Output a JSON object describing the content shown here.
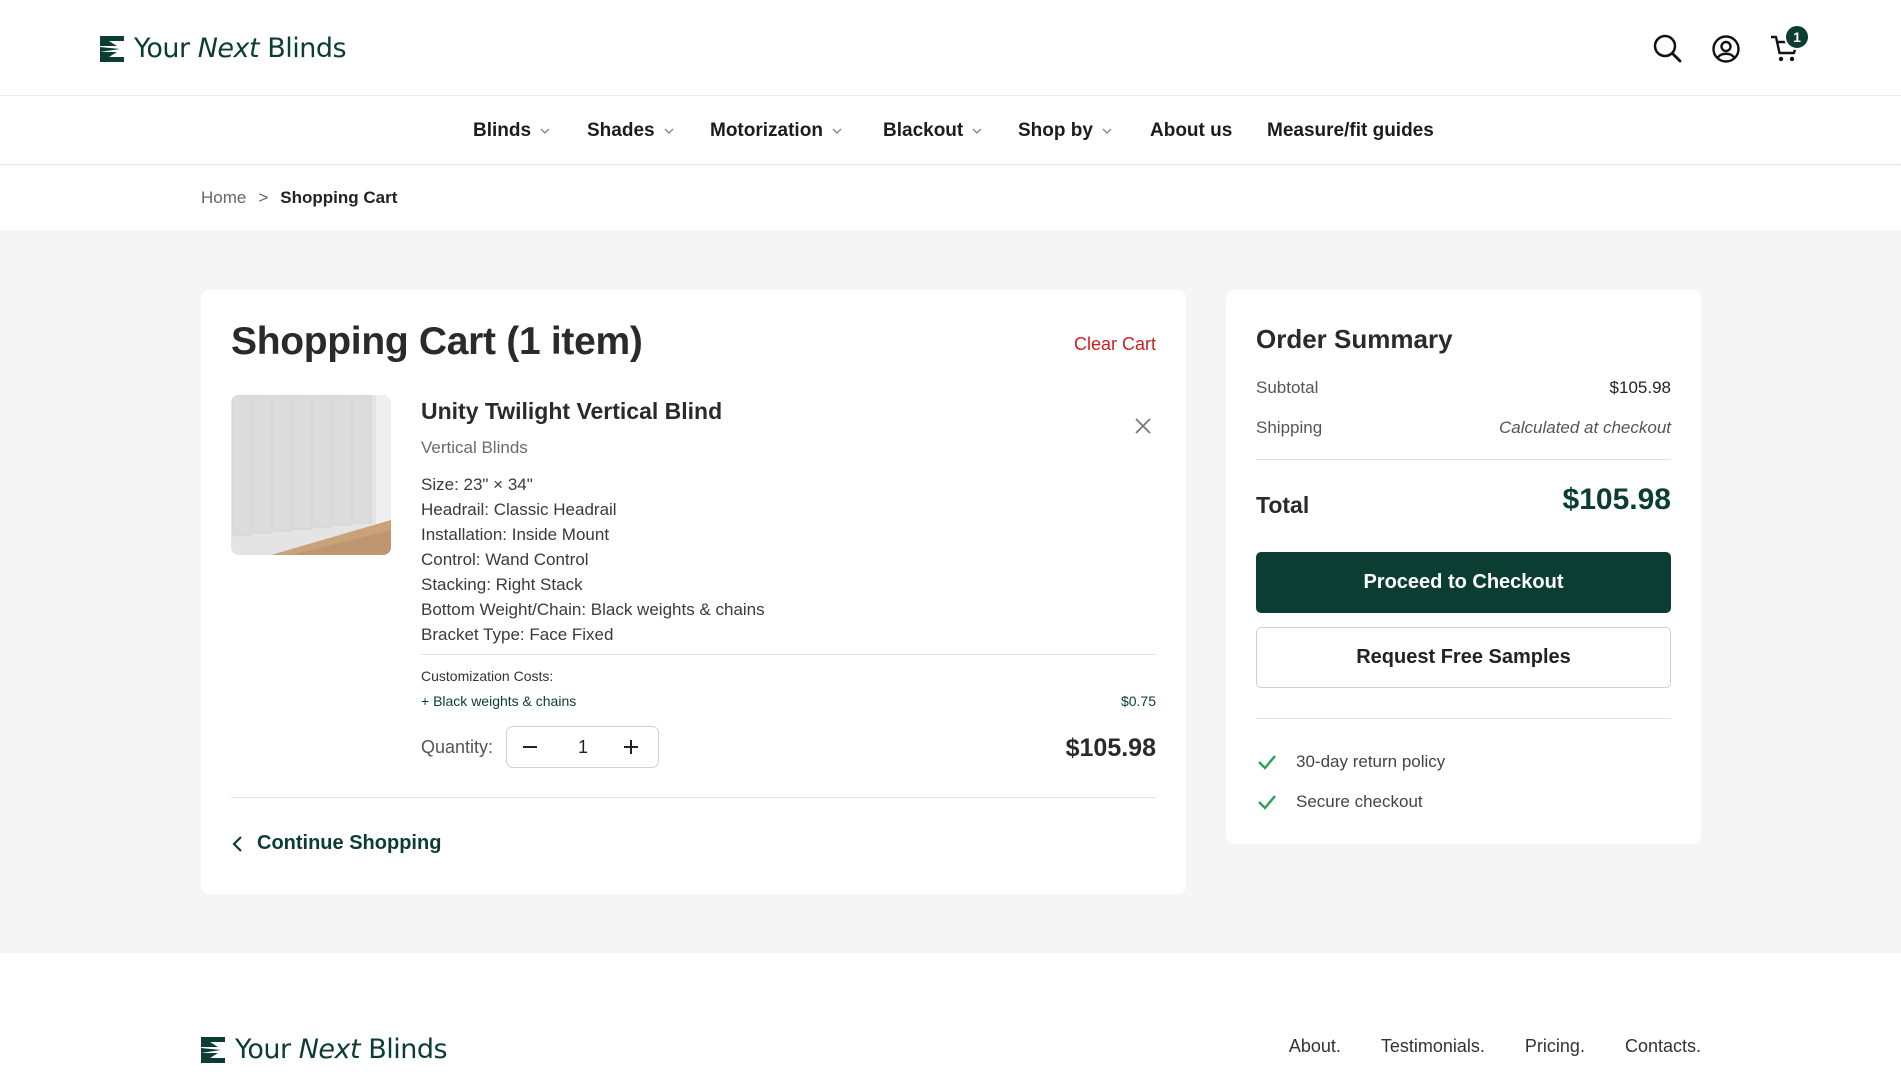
{
  "brand": {
    "word1": "Your",
    "word2": "Next",
    "word3": "Blinds",
    "color": "#0b3d33"
  },
  "header": {
    "icons": [
      "search-icon",
      "account-icon",
      "cart-icon"
    ],
    "cart_count": "1"
  },
  "nav": {
    "items": [
      {
        "label": "Blinds",
        "dropdown": true
      },
      {
        "label": "Shades",
        "dropdown": true
      },
      {
        "label": "Motorization",
        "dropdown": true
      },
      {
        "label": "Blackout",
        "dropdown": true
      },
      {
        "label": "Shop by",
        "dropdown": true
      },
      {
        "label": "About us",
        "dropdown": false
      },
      {
        "label": "Measure/fit guides",
        "dropdown": false
      }
    ]
  },
  "breadcrumb": {
    "home": "Home",
    "separator": ">",
    "current": "Shopping Cart"
  },
  "cart": {
    "title": "Shopping Cart (1 item)",
    "clear_label": "Clear Cart",
    "item": {
      "name": "Unity Twilight Vertical Blind",
      "category": "Vertical Blinds",
      "specs": [
        "Size: 23\" × 34\"",
        "Headrail: Classic Headrail",
        "Installation: Inside Mount",
        "Control: Wand Control",
        "Stacking: Right Stack",
        "Bottom Weight/Chain: Black weights & chains",
        "Bracket Type: Face Fixed"
      ],
      "customization_title": "Customization Costs:",
      "customization_line": "+ Black weights & chains",
      "customization_price": "$0.75",
      "quantity_label": "Quantity:",
      "quantity": "1",
      "line_total": "$105.98"
    },
    "continue_label": "Continue Shopping"
  },
  "summary": {
    "title": "Order Summary",
    "subtotal_label": "Subtotal",
    "subtotal_value": "$105.98",
    "shipping_label": "Shipping",
    "shipping_value": "Calculated at checkout",
    "total_label": "Total",
    "total_value": "$105.98",
    "checkout_label": "Proceed to Checkout",
    "samples_label": "Request Free Samples",
    "perks": [
      "30-day return policy",
      "Secure checkout"
    ]
  },
  "footer": {
    "links": [
      "About.",
      "Testimonials.",
      "Pricing.",
      "Contacts."
    ]
  },
  "colors": {
    "primary": "#0b3d33",
    "danger": "#cc1f1f",
    "check": "#2e9e5b",
    "page_bg": "#f5f5f5"
  }
}
